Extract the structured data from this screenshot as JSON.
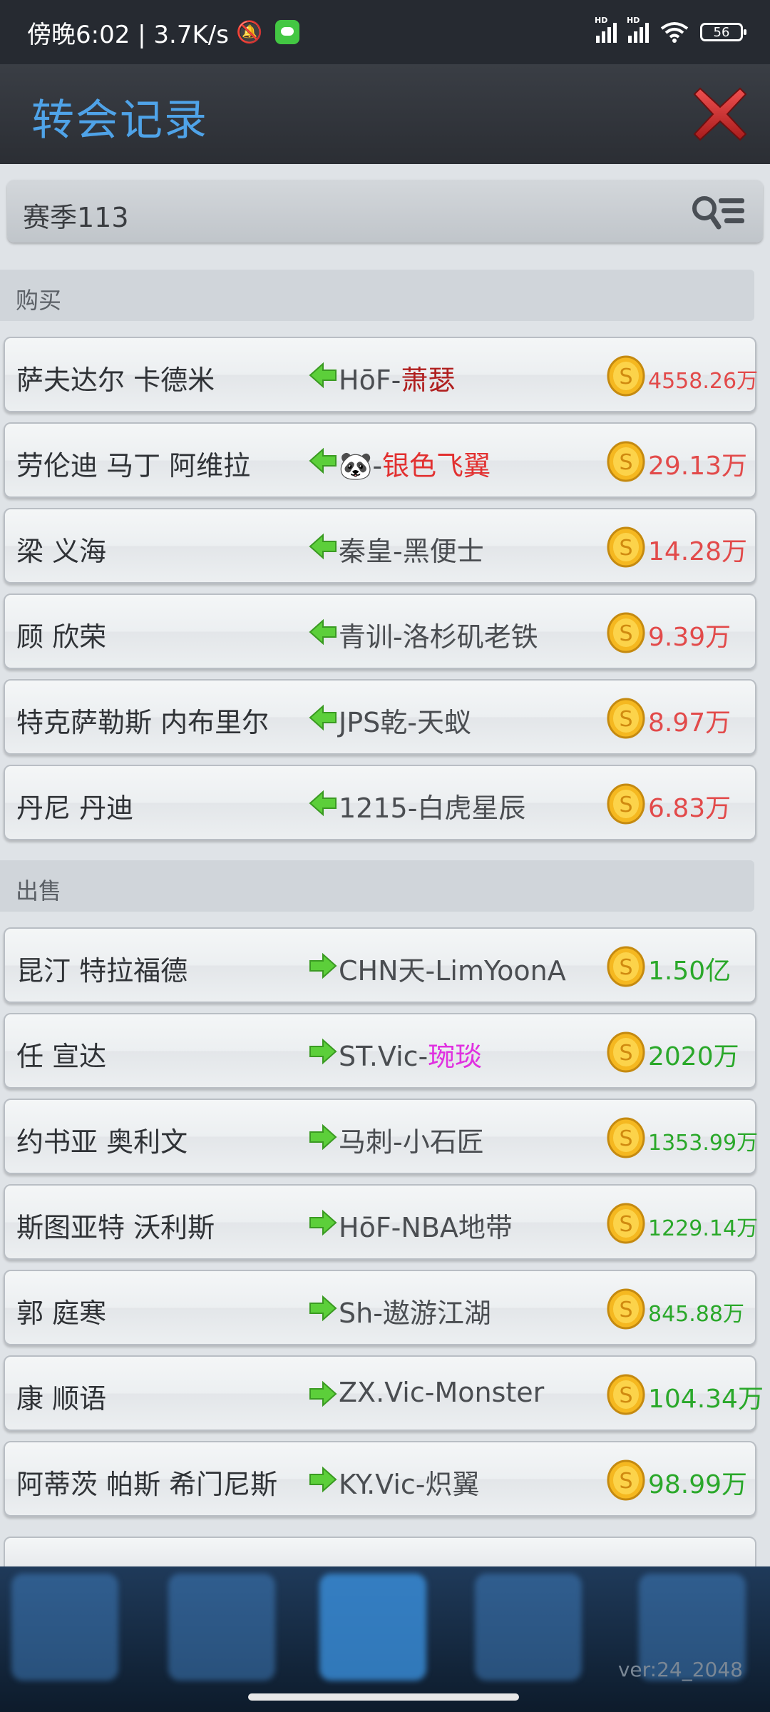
{
  "status_bar": {
    "time_text": "傍晚6:02 | 3.7K/s",
    "battery": "56",
    "hd_label": "HD"
  },
  "header": {
    "title": "转会记录",
    "colors": {
      "title": "#4fa3e8",
      "close": "#d93a3a"
    }
  },
  "season": {
    "label": "赛季113"
  },
  "sections": {
    "buy_label": "购买",
    "sell_label": "出售"
  },
  "buy_rows": [
    {
      "player": "萨夫达尔 卡德米",
      "club_prefix": "HōF-",
      "club_name": "萧瑟",
      "club_name_color": "#b01f1f",
      "price": "4558.26万"
    },
    {
      "player": "劳伦迪 马丁 阿维拉",
      "club_prefix": "🐼-",
      "club_name": "银色飞翼",
      "club_name_color": "#e23030",
      "price": "29.13万"
    },
    {
      "player": "梁 义海",
      "club_prefix": "秦皇-",
      "club_name": "黑便士",
      "club_name_color": "#4a4d51",
      "price": "14.28万"
    },
    {
      "player": "顾 欣荣",
      "club_prefix": "青训-",
      "club_name": "洛杉矶老铁",
      "club_name_color": "#4a4d51",
      "price": "9.39万"
    },
    {
      "player": "特克萨勒斯 内布里尔",
      "club_prefix": "JPS乾-",
      "club_name": "天蚁",
      "club_name_color": "#4a4d51",
      "price": "8.97万"
    },
    {
      "player": "丹尼 丹迪",
      "club_prefix": "1215-",
      "club_name": "白虎星辰",
      "club_name_color": "#4a4d51",
      "price": "6.83万"
    }
  ],
  "sell_rows": [
    {
      "player": "昆汀 特拉福德",
      "club_prefix": "CHN天-",
      "club_name": "LimYoonA",
      "club_name_color": "#4a4d51",
      "price": "1.50亿"
    },
    {
      "player": "任 宣达",
      "club_prefix": "ST.Vic-",
      "club_name": "琬琰",
      "club_name_color": "#e030e0",
      "price": "2020万"
    },
    {
      "player": "约书亚 奥利文",
      "club_prefix": "马刺-",
      "club_name": "小石匠",
      "club_name_color": "#4a4d51",
      "price": "1353.99万"
    },
    {
      "player": "斯图亚特 沃利斯",
      "club_prefix": "HōF-",
      "club_name": "NBA地带",
      "club_name_color": "#4a4d51",
      "price": "1229.14万"
    },
    {
      "player": "郭 庭寒",
      "club_prefix": "Sh-",
      "club_name": "遨游江湖",
      "club_name_color": "#4a4d51",
      "price": "845.88万"
    },
    {
      "player": "康 顺语",
      "club_prefix": "ZX.Vic-",
      "club_name": "Monster",
      "club_name_color": "#4a4d51",
      "price": "104.34万"
    },
    {
      "player": "阿蒂茨 帕斯 希门尼斯",
      "club_prefix": "KY.Vic-",
      "club_name": "炽翼",
      "club_name_color": "#4a4d51",
      "price": "98.99万"
    }
  ],
  "footer": {
    "version": "ver:24_2048"
  },
  "icons": {
    "buy_arrow": "arrow-left-icon",
    "sell_arrow": "arrow-right-icon",
    "coin": "coin-icon",
    "close": "close-icon",
    "filter": "search-list-icon"
  },
  "colors": {
    "buy_price": "#e24a4a",
    "sell_price": "#2aa82a",
    "arrow_green": "#5ccf3a"
  }
}
